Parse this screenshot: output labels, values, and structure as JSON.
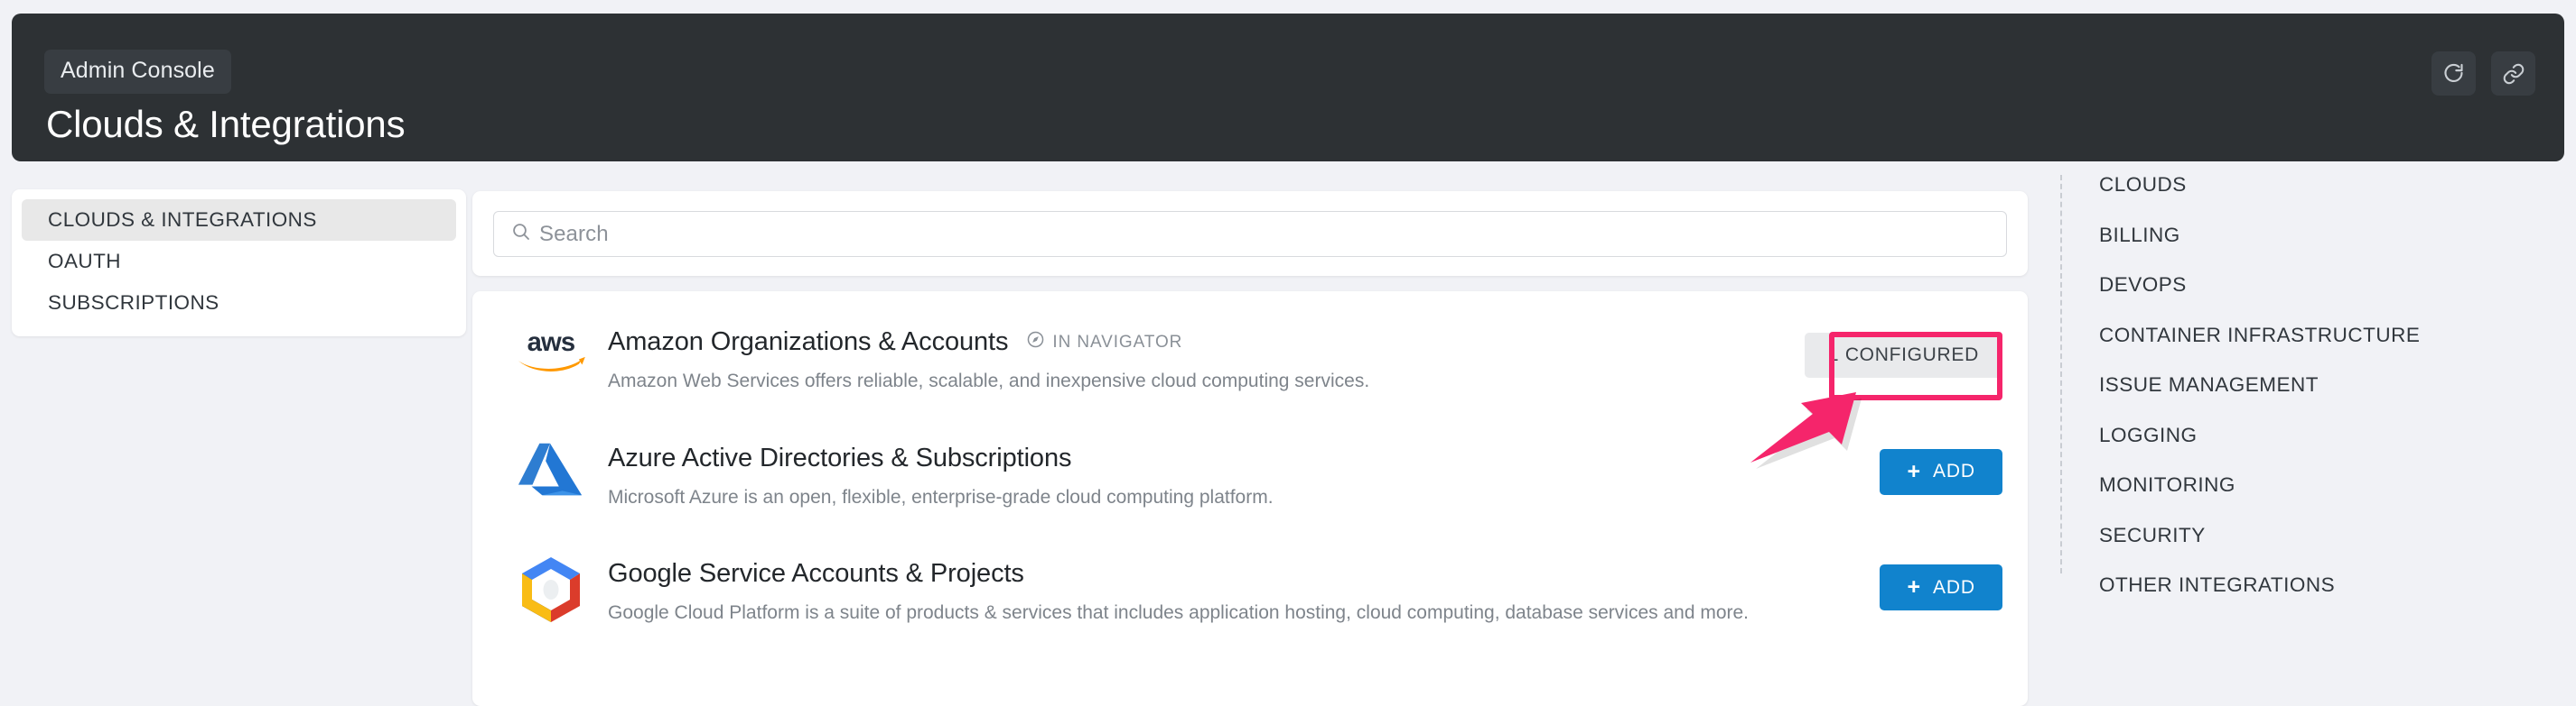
{
  "header": {
    "breadcrumb": "Admin Console",
    "title": "Clouds & Integrations",
    "actions": [
      {
        "name": "refresh-button",
        "icon": "refresh-icon"
      },
      {
        "name": "link-button",
        "icon": "link-icon"
      }
    ],
    "background_color": "#2d3134",
    "chip_color": "#383d42"
  },
  "sidebar": {
    "items": [
      {
        "label": "CLOUDS & INTEGRATIONS",
        "active": true
      },
      {
        "label": "OAUTH",
        "active": false
      },
      {
        "label": "SUBSCRIPTIONS",
        "active": false
      }
    ]
  },
  "search": {
    "value": "",
    "placeholder": "Search",
    "icon": "search-icon"
  },
  "integrations": [
    {
      "id": "aws",
      "logo": "aws-logo",
      "title": "Amazon Organizations & Accounts",
      "badge": "IN NAVIGATOR",
      "badge_icon": "compass-icon",
      "description": "Amazon Web Services offers reliable, scalable, and inexpensive cloud computing services.",
      "action": {
        "type": "configured",
        "label": "1 CONFIGURED",
        "highlighted": true
      }
    },
    {
      "id": "azure",
      "logo": "azure-logo",
      "title": "Azure Active Directories & Subscriptions",
      "badge": "",
      "description": "Microsoft Azure is an open, flexible, enterprise-grade cloud computing platform.",
      "action": {
        "type": "add",
        "label": "ADD",
        "plus": "+",
        "highlighted": false
      }
    },
    {
      "id": "google",
      "logo": "google-cloud-logo",
      "title": "Google Service Accounts & Projects",
      "badge": "",
      "description": "Google Cloud Platform is a suite of products & services that includes application hosting, cloud computing, database services and more.",
      "action": {
        "type": "add",
        "label": "ADD",
        "plus": "+",
        "highlighted": false
      }
    }
  ],
  "categories": [
    "CLOUDS",
    "BILLING",
    "DEVOPS",
    "CONTAINER INFRASTRUCTURE",
    "ISSUE MANAGEMENT",
    "LOGGING",
    "MONITORING",
    "SECURITY",
    "OTHER INTEGRATIONS"
  ],
  "annotation": {
    "color": "#f5256b",
    "target": "1 CONFIGURED"
  },
  "colors": {
    "page_background": "#f1f2f6",
    "card_background": "#ffffff",
    "accent_blue": "#1183cd",
    "annotation_pink": "#f5256b"
  }
}
